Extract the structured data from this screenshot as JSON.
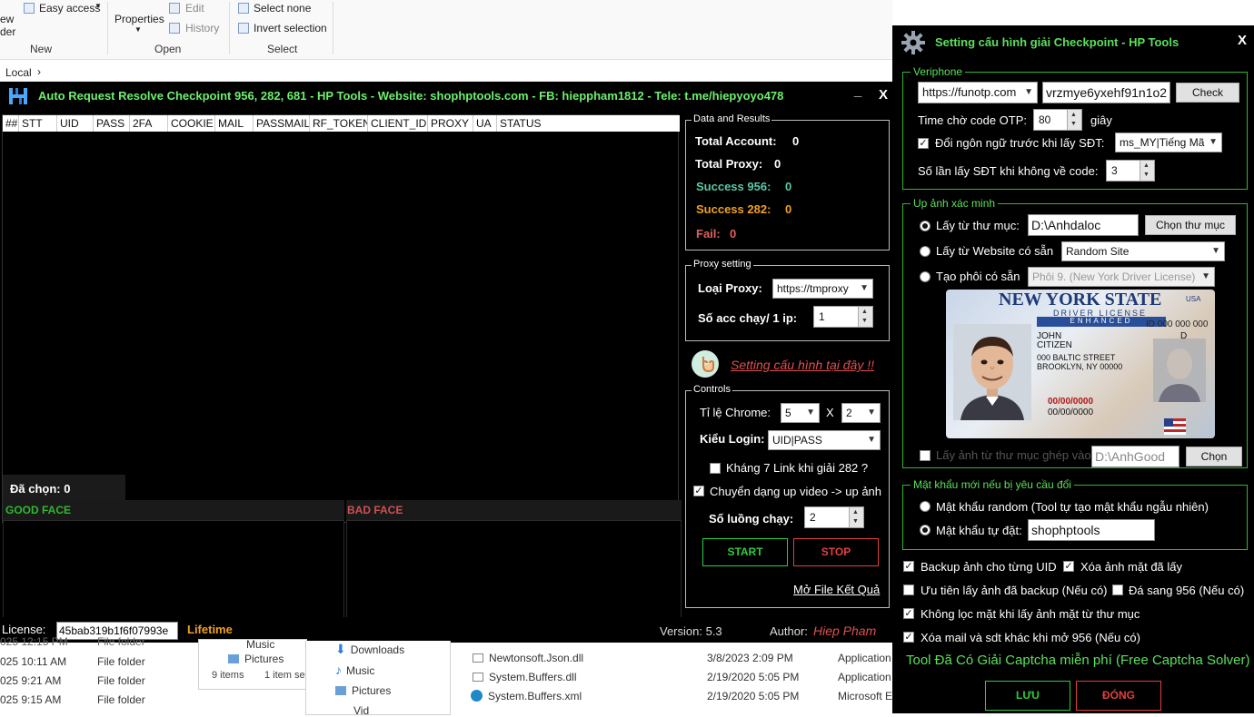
{
  "explorer": {
    "ribbon": {
      "new_folder_line1": "ew",
      "new_folder_line2": "der",
      "easy_access": "Easy access",
      "group_new": "New",
      "properties": "Properties",
      "edit": "Edit",
      "history": "History",
      "group_open": "Open",
      "select_none": "Select none",
      "invert_selection": "Invert selection",
      "group_select": "Select"
    },
    "address": "Local",
    "rows": [
      {
        "date": "025 12:15 PM",
        "type": "File folder"
      },
      {
        "date": "025 10:11 AM",
        "type": "File folder"
      },
      {
        "date": "025 9:21 AM",
        "type": "File folder"
      },
      {
        "date": "025 9:15 AM",
        "type": "File folder"
      }
    ],
    "popup": {
      "music": "Music",
      "pictures": "Pictures",
      "items": "9 items",
      "selected": "1 item se"
    },
    "nav": {
      "downloads": "Downloads",
      "music": "Music",
      "pictures": "Pictures",
      "videos": "Vid"
    },
    "files": [
      {
        "name": "Newtonsoft.Json.dll",
        "date": "3/8/2023 2:09 PM",
        "type": "Application"
      },
      {
        "name": "System.Buffers.dll",
        "date": "2/19/2020 5:05 PM",
        "type": "Application"
      },
      {
        "name": "System.Buffers.xml",
        "date": "2/19/2020 5:05 PM",
        "type": "Microsoft E"
      }
    ]
  },
  "app": {
    "title": "Auto Request Resolve Checkpoint 956, 282, 681 - HP Tools - Website: shophptools.com - FB: hieppham1812 - Tele: t.me/hiepyoyo478",
    "minimize": "_",
    "close": "X",
    "columns": [
      "##",
      "STT",
      "UID",
      "PASS",
      "2FA",
      "COOKIE",
      "MAIL",
      "PASSMAIL",
      "RF_TOKEN",
      "CLIENT_ID",
      "PROXY",
      "UA",
      "STATUS"
    ],
    "selected_label": "Đã chọn:",
    "selected_count": "0",
    "good_face": "GOOD FACE",
    "bad_face": "BAD FACE",
    "data_results": {
      "label": "Data and Results",
      "total_account_label": "Total Account:",
      "total_account": "0",
      "total_proxy_label": "Total Proxy:",
      "total_proxy": "0",
      "success956_label": "Success 956:",
      "success956": "0",
      "success282_label": "Success 282:",
      "success282": "0",
      "fail_label": "Fail:",
      "fail": "0"
    },
    "proxy": {
      "label": "Proxy setting",
      "type_label": "Loại Proxy:",
      "type_value": "https://tmproxy",
      "acc_per_ip_label": "Số acc chạy/  1 ip:",
      "acc_per_ip": "1"
    },
    "setting_link": "Setting cấu hình tại đây !!",
    "controls": {
      "label": "Controls",
      "chrome_ratio_label": "Tỉ lệ Chrome:",
      "ratio_a": "5",
      "x": "X",
      "ratio_b": "2",
      "login_label": "Kiểu Login:",
      "login_value": "UID|PASS",
      "khang7": "Kháng 7 Link khi giải 282 ?",
      "chuyen_dang": "Chuyển dạng up video -> up ảnh",
      "threads_label": "Số luồng chạy:",
      "threads": "2",
      "start": "START",
      "stop": "STOP",
      "open_result": "Mở File Kết Quả"
    },
    "status": {
      "license_label": "License:",
      "license_key": "45bab319b1f6f07993e",
      "lifetime": "Lifetime",
      "version": "Version: 5.3",
      "author_label": "Author:",
      "author": "Hiep Pham"
    }
  },
  "dialog": {
    "title": "Setting cấu hình giải Checkpoint - HP Tools",
    "close": "X",
    "veriphone": {
      "label": "Veriphone",
      "site": "https://funotp.com",
      "api_key": "vrzmye6yxehf91n1o2",
      "check": "Check",
      "otp_wait_label": "Time chờ code OTP:",
      "otp_wait": "80",
      "seconds": "giây",
      "change_lang_label": "Đổi ngôn ngữ trước khi lấy SĐT:",
      "lang": "ms_MY|Tiếng Mã",
      "retry_label": "Số lần lấy SĐT khi không về code:",
      "retry": "3"
    },
    "upload": {
      "label": "Up ảnh xác minh",
      "from_folder": "Lấy từ thư mục:",
      "folder_path": "D:\\Anhdaloc",
      "choose_folder": "Chọn thư mục",
      "from_website": "Lấy từ Website có sẵn",
      "website": "Random Site",
      "make_template": "Tạo phôi có sẵn",
      "template": "Phôi 9. (New York Driver License)",
      "merge_folder": "Lấy ảnh từ thư mục ghép vào:",
      "merge_path": "D:\\AnhGood",
      "choose": "Chọn"
    },
    "card": {
      "state": "NEW YORK STATE",
      "usa": "USA",
      "dl": "DRIVER LICENSE",
      "enhanced": "ENHANCED",
      "id": "ID 000 000 000",
      "name1": "JOHN",
      "name2": "CITIZEN",
      "addr1": "000 BALTIC STREET",
      "addr2": "BROOKLYN, NY 00000",
      "dob": "00/00/0000",
      "exp": "00/00/0000",
      "class": "D"
    },
    "password": {
      "label": "Mật khẩu mới nếu bị yêu cầu đổi",
      "random": "Mật khẩu random (Tool tự tạo mật khẩu ngẫu nhiên)",
      "custom_label": "Mật khẩu tự đặt:",
      "custom": "shophptools"
    },
    "options": {
      "backup": "Backup ảnh cho từng UID",
      "delete_used": "Xóa ảnh mặt đã lấy",
      "prefer_backup": "Ưu tiên lấy ảnh đã backup (Nếu có)",
      "go_956": "Đá sang 956 (Nếu có)",
      "no_filter": "Không lọc mặt khi lấy ảnh mặt từ thư mục",
      "delete_mail": "Xóa mail và sdt khác khi mở 956 (Nếu có)"
    },
    "captcha_note": "Tool Đã Có Giải Captcha miễn phí (Free Captcha Solver)",
    "save": "LƯU",
    "close_btn": "ĐÓNG"
  },
  "colors": {
    "green": "#5be05b",
    "teal": "#5ac8a8",
    "orange": "#f0a020",
    "red": "#e06060",
    "link": "#e05050"
  }
}
